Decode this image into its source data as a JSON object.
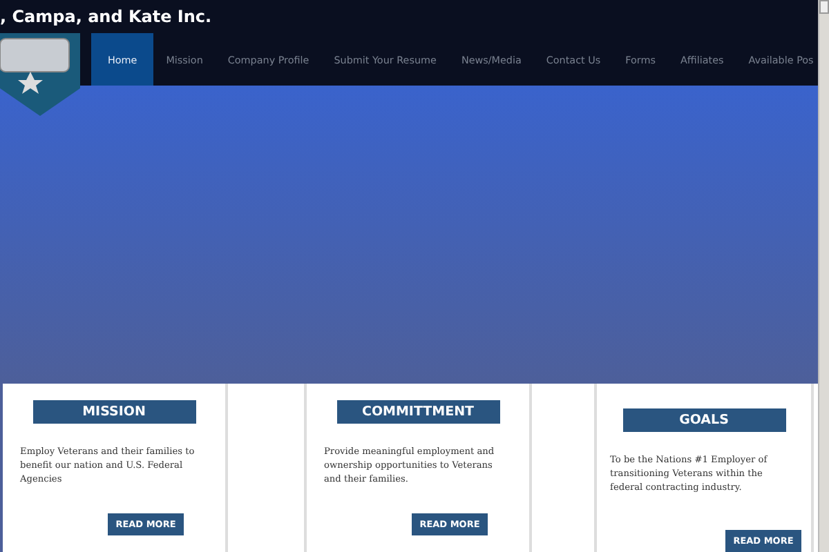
{
  "header": {
    "title": ", Campa, and Kate Inc."
  },
  "nav": [
    {
      "label": "Home",
      "selected": true
    },
    {
      "label": "Mission",
      "selected": false
    },
    {
      "label": "Company Profile",
      "selected": false
    },
    {
      "label": "Submit Your Resume",
      "selected": false
    },
    {
      "label": "News/Media",
      "selected": false
    },
    {
      "label": "Contact Us",
      "selected": false
    },
    {
      "label": "Forms",
      "selected": false
    },
    {
      "label": "Affiliates",
      "selected": false
    },
    {
      "label": "Available Pos",
      "selected": false
    }
  ],
  "cards": [
    {
      "heading": "MISSION",
      "text": "Employ Veterans and their families to benefit our nation and U.S. Federal Agencies",
      "button": "READ MORE"
    },
    {
      "heading": "COMMITTMENT",
      "text": "Provide meaningful employment and ownership opportunities to Veterans and their families.",
      "button": "READ MORE"
    },
    {
      "heading": "GOALS",
      "text": "To be the Nations #1 Employer of transitioning Veterans within the federal contracting industry.",
      "button": "READ MORE"
    }
  ]
}
